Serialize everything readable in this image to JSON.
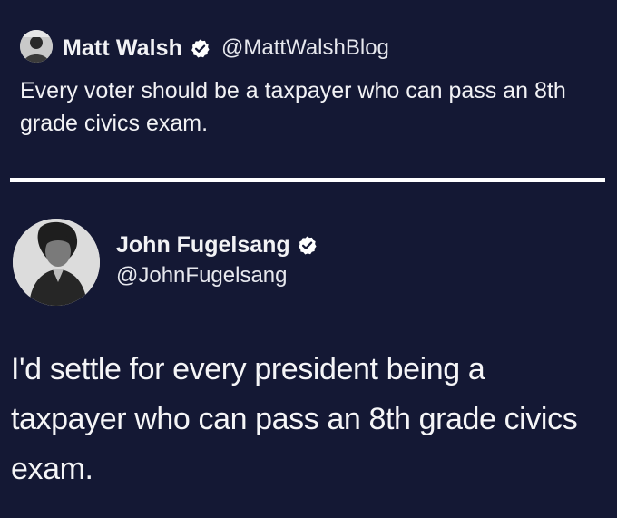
{
  "original_tweet": {
    "author_name": "Matt Walsh",
    "author_handle": "@MattWalshBlog",
    "verified": true,
    "text": "Every voter should be a taxpayer who can pass an 8th grade civics exam."
  },
  "reply_tweet": {
    "author_name": "John Fugelsang",
    "author_handle": "@JohnFugelsang",
    "verified": true,
    "text": "I'd settle for every president being a taxpayer who can pass an 8th grade civics exam."
  },
  "colors": {
    "background": "#141834",
    "text": "#f2f2f5",
    "divider": "#ffffff",
    "verified_badge": "#ffffff"
  },
  "icons": {
    "verified": "verified-badge-icon"
  }
}
